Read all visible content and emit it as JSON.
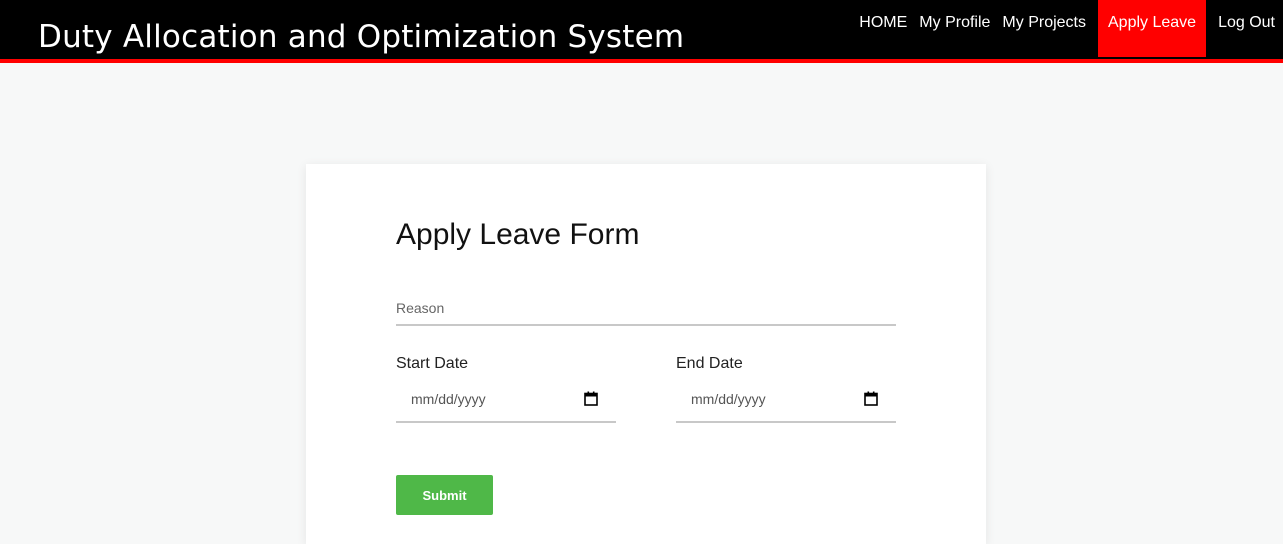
{
  "header": {
    "title": "Duty Allocation and Optimization System",
    "nav": [
      {
        "label": "HOME"
      },
      {
        "label": "My Profile"
      },
      {
        "label": "My Projects"
      },
      {
        "label": "Apply Leave",
        "active": true
      },
      {
        "label": "Log Out"
      }
    ],
    "colors": {
      "bar": "#000000",
      "accent": "#ff0000"
    }
  },
  "form": {
    "title": "Apply Leave Form",
    "reason_placeholder": "Reason",
    "start_label": "Start Date",
    "end_label": "End Date",
    "start_placeholder": "mm/dd/yyyy",
    "end_placeholder": "mm/dd/yyyy",
    "date_icon": "calendar-icon",
    "submit_label": "Submit",
    "submit_color": "#4fb848"
  }
}
